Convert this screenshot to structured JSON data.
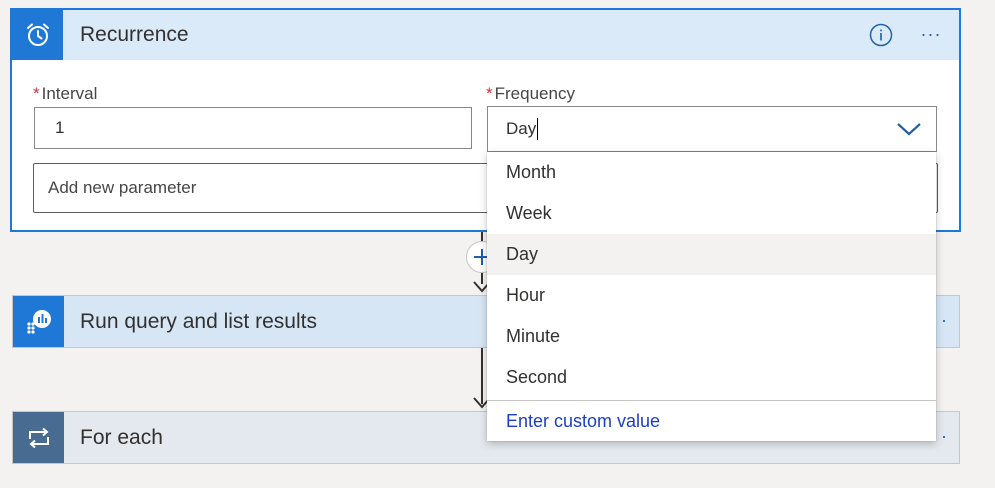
{
  "recurrence": {
    "title": "Recurrence",
    "interval_label": "Interval",
    "interval_value": "1",
    "frequency_label": "Frequency",
    "frequency_value": "Day",
    "required_mark": "*",
    "add_param_placeholder": "Add new parameter",
    "more_label": "···"
  },
  "frequency_options": [
    "Month",
    "Week",
    "Day",
    "Hour",
    "Minute",
    "Second"
  ],
  "selected_option": "Day",
  "custom_value_label": "Enter custom value",
  "actions": {
    "run_query_title": "Run query and list results",
    "for_each_title": "For each"
  },
  "colors": {
    "accent": "#1f78d6",
    "header_bg": "#dbeaf9",
    "link": "#1b3ec4",
    "required": "#d13438"
  },
  "icons": {
    "recurrence": "alarm-clock-icon",
    "info": "info-icon",
    "chevron": "chevron-down-icon",
    "run_query": "log-analytics-icon",
    "for_each": "loop-icon",
    "add_step": "plus-icon"
  }
}
